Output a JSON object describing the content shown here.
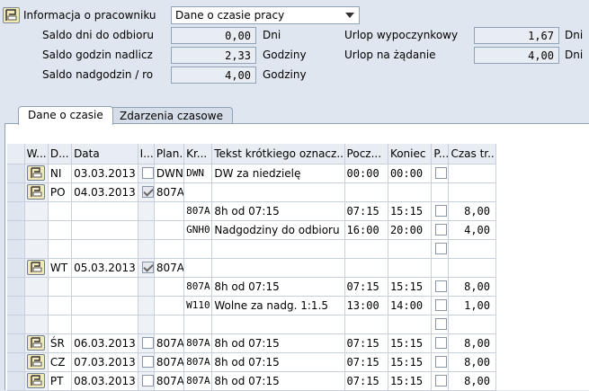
{
  "header": {
    "info_label": "Informacja o pracowniku",
    "dropdown_value": "Dane o czasie pracy"
  },
  "balances": {
    "left": [
      {
        "label": "Saldo dni do odbioru",
        "value": "0,00",
        "unit": "Dni"
      },
      {
        "label": "Saldo godzin nadlicz",
        "value": "2,33",
        "unit": "Godziny"
      },
      {
        "label": "Saldo nadgodzin / ro",
        "value": "4,00",
        "unit": "Godziny"
      }
    ],
    "right": [
      {
        "label": "Urlop wypoczynkowy",
        "value": "1,67",
        "unit": "Dni"
      },
      {
        "label": "Urlop na żądanie",
        "value": "4,00",
        "unit": "Dni"
      }
    ]
  },
  "tabs": [
    {
      "label": "Dane o czasie",
      "active": true
    },
    {
      "label": "Zdarzenia czasowe",
      "active": false
    }
  ],
  "grid": {
    "columns": [
      "W...",
      "D...",
      "Data",
      "I...",
      "Plan.",
      "Kr...",
      "Tekst krótkiego oznacz...",
      "Pocz...",
      "Koniec",
      "P...",
      "Czas tr..."
    ],
    "rows": [
      {
        "icon": true,
        "day": "NI",
        "date": "03.03.2013",
        "checkbox_i": "unchecked",
        "plan": "DWN",
        "kr": "DWN",
        "text": "DW za niedzielę",
        "start": "00:00",
        "end": "00:00",
        "p": "unchecked",
        "time": ""
      },
      {
        "icon": true,
        "day": "PO",
        "date": "04.03.2013",
        "checkbox_i": "checked",
        "plan": "807A",
        "kr": "",
        "text": "",
        "start": "",
        "end": "",
        "p": "none",
        "time": ""
      },
      {
        "icon": false,
        "day": "",
        "date": "",
        "checkbox_i": "none",
        "plan": "",
        "kr": "807A",
        "text": "8h od 07:15",
        "start": "07:15",
        "end": "15:15",
        "p": "unchecked",
        "time": "8,00"
      },
      {
        "icon": false,
        "day": "",
        "date": "",
        "checkbox_i": "none",
        "plan": "",
        "kr": "GNH0",
        "text": "Nadgodziny do odbioru",
        "start": "16:00",
        "end": "20:00",
        "p": "unchecked",
        "time": "4,00"
      },
      {
        "icon": false,
        "day": "",
        "date": "",
        "checkbox_i": "none",
        "plan": "",
        "kr": "",
        "text": "",
        "start": "",
        "end": "",
        "p": "unchecked",
        "time": ""
      },
      {
        "icon": true,
        "day": "WT",
        "date": "05.03.2013",
        "checkbox_i": "checked",
        "plan": "807A",
        "kr": "",
        "text": "",
        "start": "",
        "end": "",
        "p": "none",
        "time": ""
      },
      {
        "icon": false,
        "day": "",
        "date": "",
        "checkbox_i": "none",
        "plan": "",
        "kr": "807A",
        "text": "8h od 07:15",
        "start": "07:15",
        "end": "15:15",
        "p": "unchecked",
        "time": "8,00"
      },
      {
        "icon": false,
        "day": "",
        "date": "",
        "checkbox_i": "none",
        "plan": "",
        "kr": "W110",
        "text": "Wolne za nadg. 1:1.5",
        "start": "13:00",
        "end": "14:00",
        "p": "unchecked",
        "time": "1,00"
      },
      {
        "icon": false,
        "day": "",
        "date": "",
        "checkbox_i": "none",
        "plan": "",
        "kr": "",
        "text": "",
        "start": "",
        "end": "",
        "p": "unchecked",
        "time": ""
      },
      {
        "icon": true,
        "day": "ŚR",
        "date": "06.03.2013",
        "checkbox_i": "unchecked",
        "plan": "807A",
        "kr": "807A",
        "text": "8h od 07:15",
        "start": "07:15",
        "end": "15:15",
        "p": "unchecked",
        "time": "8,00"
      },
      {
        "icon": true,
        "day": "CZ",
        "date": "07.03.2013",
        "checkbox_i": "unchecked",
        "plan": "807A",
        "kr": "807A",
        "text": "8h od 07:15",
        "start": "07:15",
        "end": "15:15",
        "p": "unchecked",
        "time": "8,00"
      },
      {
        "icon": true,
        "day": "PT",
        "date": "08.03.2013",
        "checkbox_i": "unchecked",
        "plan": "807A",
        "kr": "807A",
        "text": "8h od 07:15",
        "start": "07:15",
        "end": "15:15",
        "p": "unchecked",
        "time": "8,00"
      }
    ]
  }
}
